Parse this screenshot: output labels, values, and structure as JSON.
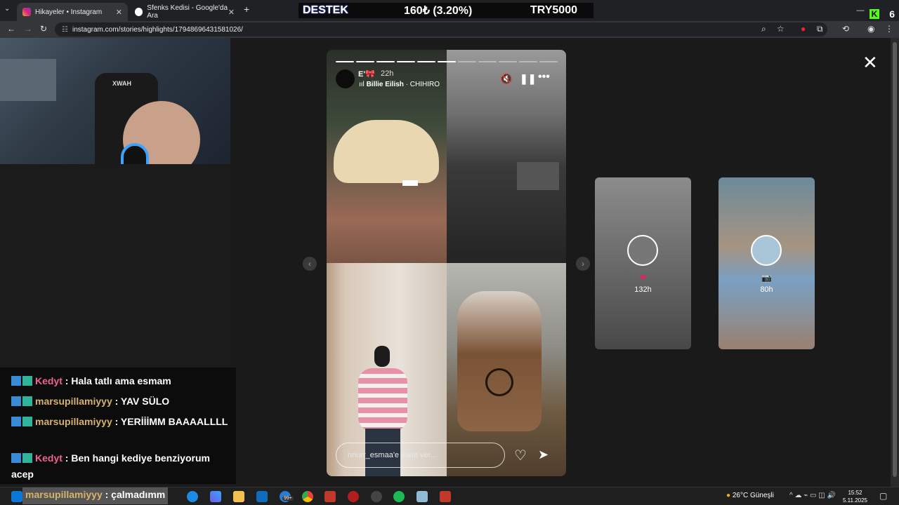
{
  "browser": {
    "tabs": [
      {
        "label": "Hikayeler • Instagram",
        "close": "✕"
      },
      {
        "label": "Sfenks Kedisi - Google'da Ara",
        "close": "✕"
      }
    ],
    "new_tab": "+",
    "url": "instagram.com/stories/highlights/17948696431581026/",
    "overlay": {
      "left": "DESTEK",
      "middle": "160₺ (3.20%)",
      "right": "TRY5000"
    },
    "kick_count": "6",
    "kick_letter": "K"
  },
  "webcam": {
    "chair_brand": "XWAH"
  },
  "story": {
    "username": "E'🎀",
    "time": "22h",
    "music_artist": "Billie Eilish",
    "music_track": " · CHIHIRO",
    "music_prefix": "ııl ",
    "reply_placeholder": "nnurr_esmaa'e yanıt ver...",
    "progress_segments": 11,
    "progress_done": 6
  },
  "previews": [
    {
      "icon": "❤",
      "count": "132h"
    },
    {
      "icon": "📷",
      "count": "80h"
    }
  ],
  "chat": {
    "messages": [
      {
        "user": "Kedyt",
        "text": ": Hala tatlı ama esmam",
        "color": "pink"
      },
      {
        "user": "marsupillamiyyy",
        "text": ": YAV SÜLO",
        "color": "gold"
      },
      {
        "user": "marsupillamiyyy",
        "text": ": YERİİİMM BAAAALLLL",
        "color": "gold"
      },
      {
        "user": "Kedyt",
        "text": ": Ben hangi kediye benziyorum acep",
        "color": "pink"
      }
    ],
    "overflow_line": {
      "user": "marsupillamiyyy",
      "text": ": çalmadımm"
    }
  },
  "taskbar": {
    "weather": "26°C  Güneşli",
    "time": "15:52",
    "date": "5.11.2025",
    "badge_count": "99+"
  }
}
